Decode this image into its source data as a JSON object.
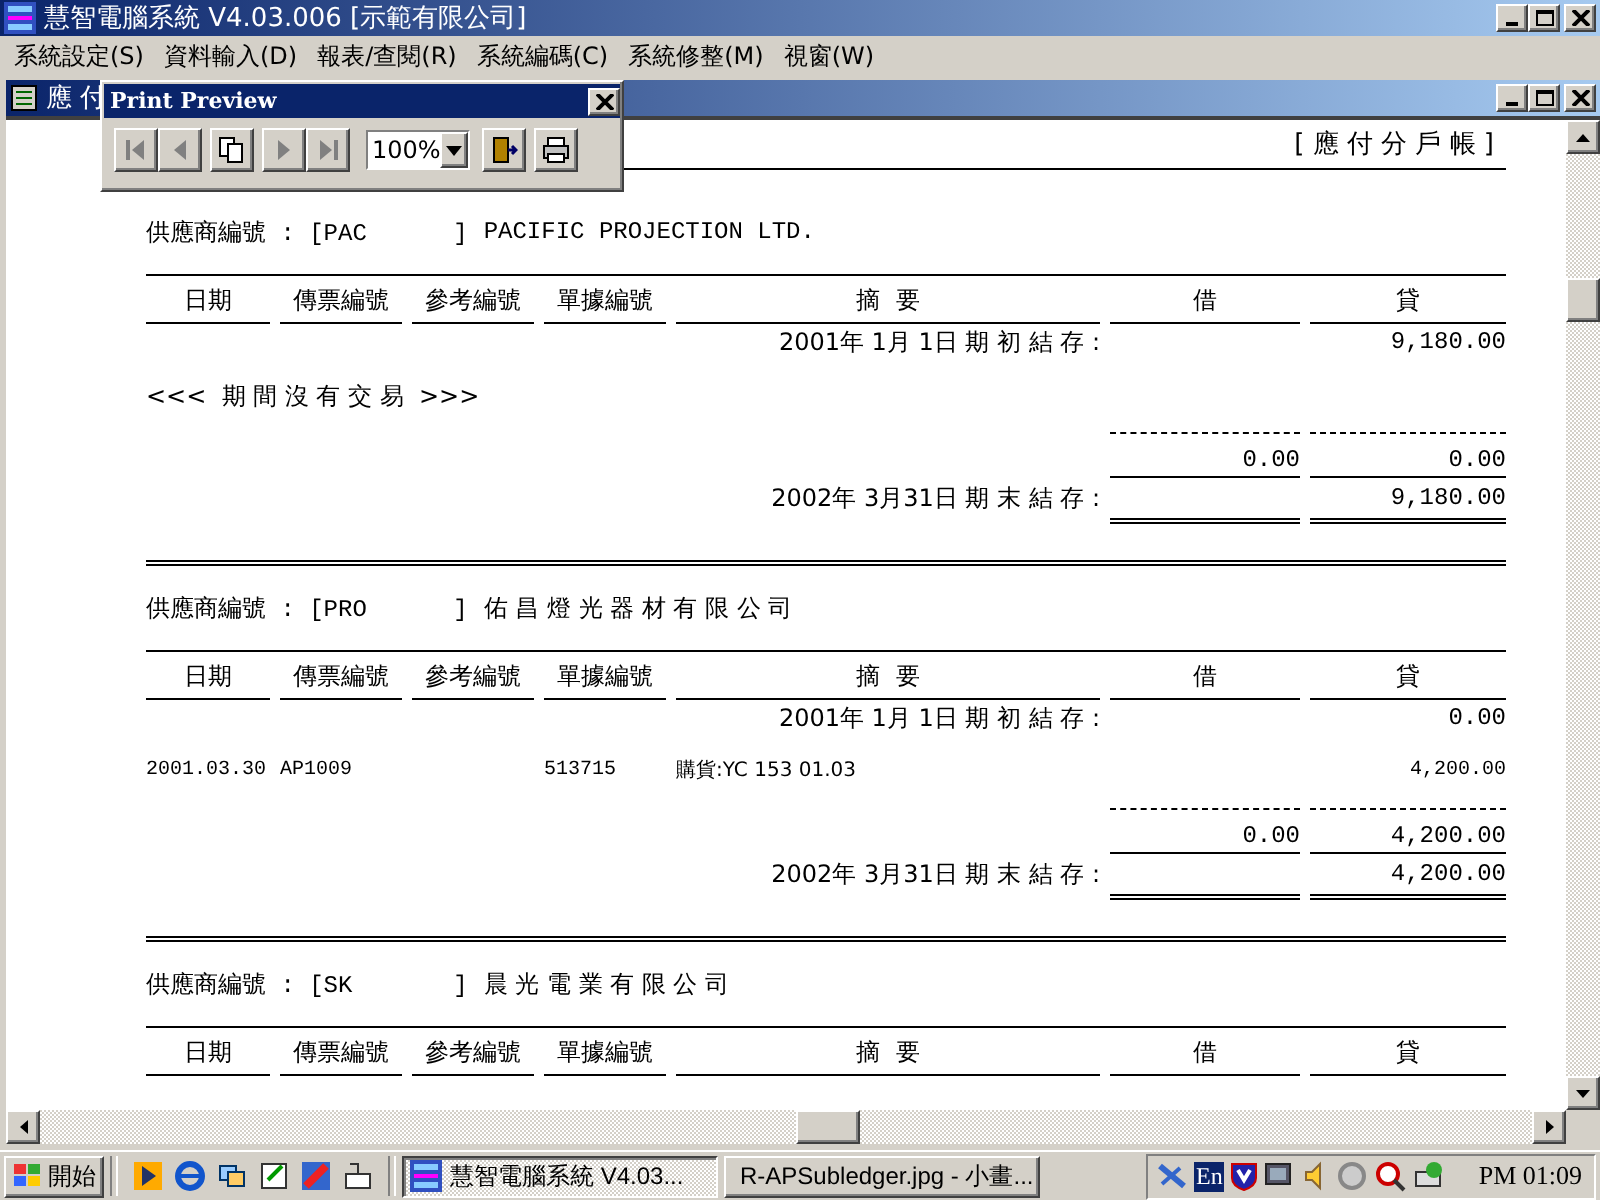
{
  "app": {
    "title": "慧智電腦系統 V4.03.006 [示範有限公司]"
  },
  "menu": [
    "系統設定(S)",
    "資料輸入(D)",
    "報表/查閱(R)",
    "系統編碼(C)",
    "系統修整(M)",
    "視窗(W)"
  ],
  "child_window": {
    "title": "應 付"
  },
  "print_preview": {
    "title": "Print Preview",
    "zoom": "100%",
    "buttons": [
      {
        "kind": "first",
        "disabled": true
      },
      {
        "kind": "prev",
        "disabled": true
      },
      {
        "kind": "pages",
        "disabled": false
      },
      {
        "kind": "next",
        "disabled": true
      },
      {
        "kind": "last",
        "disabled": true
      },
      {
        "kind": "zoom"
      },
      {
        "kind": "exit",
        "disabled": false
      },
      {
        "kind": "print",
        "disabled": false
      }
    ]
  },
  "report": {
    "title": "[ 應 付 分 戶 帳 ]",
    "suppliers": [
      {
        "label": "供應商編號 : [PAC      ]",
        "name": "PACIFIC PROJECTION LTD.",
        "columns": [
          "日期",
          "傳票編號",
          "參考編號",
          "單據編號",
          "摘  要",
          "借",
          "貸"
        ],
        "rows": [
          {
            "kind": "opening",
            "description": "2001年 1月 1日 期 初 結 存 :",
            "credit": "9,180.00"
          },
          {
            "kind": "no_transaction",
            "text": "<<<  期 間 沒 有 交 易  >>>"
          },
          {
            "kind": "subtotal",
            "debit": "0.00",
            "credit": "0.00"
          },
          {
            "kind": "closing",
            "description": "2002年 3月31日 期 末 結 存 :",
            "credit": "9,180.00"
          }
        ]
      },
      {
        "label": "供應商編號 : [PRO      ]",
        "name": "佑 昌 燈 光 器 材 有 限 公 司",
        "columns": [
          "日期",
          "傳票編號",
          "參考編號",
          "單據編號",
          "摘  要",
          "借",
          "貸"
        ],
        "rows": [
          {
            "kind": "opening",
            "description": "2001年 1月 1日 期 初 結 存 :",
            "credit": "0.00"
          },
          {
            "kind": "transaction",
            "date": "2001.03.30",
            "voucher": "AP1009",
            "document": "513715",
            "description": "購貨:YC 153 01.03",
            "credit": "4,200.00"
          },
          {
            "kind": "subtotal",
            "debit": "0.00",
            "credit": "4,200.00"
          },
          {
            "kind": "closing",
            "description": "2002年 3月31日 期 末 結 存 :",
            "credit": "4,200.00"
          }
        ]
      },
      {
        "label": "供應商編號 : [SK       ]",
        "name": "晨 光 電 業 有 限 公 司",
        "columns": [
          "日期",
          "傳票編號",
          "參考編號",
          "單據編號",
          "摘  要",
          "借",
          "貸"
        ]
      }
    ]
  },
  "taskbar": {
    "start": "開始",
    "tasks": [
      {
        "label": "慧智電腦系統 V4.03...",
        "selected": true
      },
      {
        "label": "R-APSubledger.jpg - 小畫...",
        "selected": false
      }
    ],
    "language": "En",
    "clock": "PM 01:09"
  }
}
